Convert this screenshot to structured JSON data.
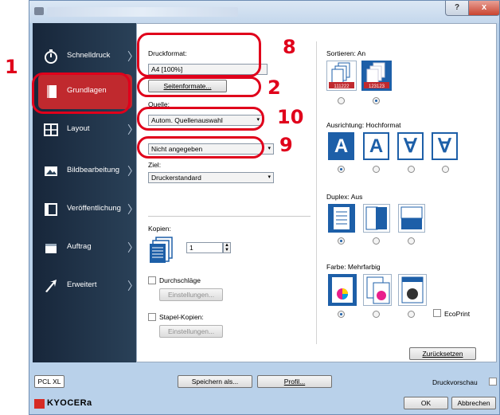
{
  "annotations": {
    "n1": "1",
    "n2": "2",
    "n8": "8",
    "n9": "9",
    "n10": "10"
  },
  "title_bar": {
    "help": "?",
    "close": "x"
  },
  "sidebar": {
    "items": [
      {
        "label": "Schnelldruck",
        "icon": "stopwatch-icon"
      },
      {
        "label": "Grundlagen",
        "icon": "page-icon"
      },
      {
        "label": "Layout",
        "icon": "layout-icon"
      },
      {
        "label": "Bildbearbeitung",
        "icon": "image-icon"
      },
      {
        "label": "Veröffentlichung",
        "icon": "publish-icon"
      },
      {
        "label": "Auftrag",
        "icon": "job-icon"
      },
      {
        "label": "Erweitert",
        "icon": "arrow-icon"
      }
    ]
  },
  "left": {
    "druckformat_label": "Druckformat:",
    "druckformat_value": "A4  [100%]",
    "seitenformate_button": "Seitenformate...",
    "quelle_label": "Quelle:",
    "quelle_value": "Autom. Quellenauswahl",
    "medientyp_value": "Nicht angegeben",
    "ziel_label": "Ziel:",
    "ziel_value": "Druckerstandard",
    "kopien_label": "Kopien:",
    "kopien_value": "1",
    "durchschlaege_label": "Durchschläge",
    "durchschlaege_settings": "Einstellungen...",
    "stapel_label": "Stapel-Kopien:",
    "stapel_settings": "Einstellungen..."
  },
  "right": {
    "sortieren_label": "Sortieren: An",
    "ausrichtung_label": "Ausrichtung: Hochformat",
    "orient_glyph": "A",
    "orient_glyph_flip": "∀",
    "duplex_label": "Duplex: Aus",
    "farbe_label": "Farbe: Mehrfarbig",
    "ecoprint_label": "EcoPrint",
    "reset_button": "Zurücksetzen",
    "collate_on_text": "123123",
    "collate_off_text": "111222"
  },
  "footer": {
    "driver_label": "PCL XL",
    "save_button": "Speichern als...",
    "profile_button": "Profil...",
    "preview_label": "Druckvorschau",
    "brand": "KYOCERa",
    "ok_button": "OK",
    "cancel_button": "Abbrechen"
  },
  "colors": {
    "accent_blue": "#1d5fa8",
    "highlight_red": "#e0001b",
    "sidebar_active": "#c0292e",
    "sidebar_bg": "#1c2c40"
  }
}
